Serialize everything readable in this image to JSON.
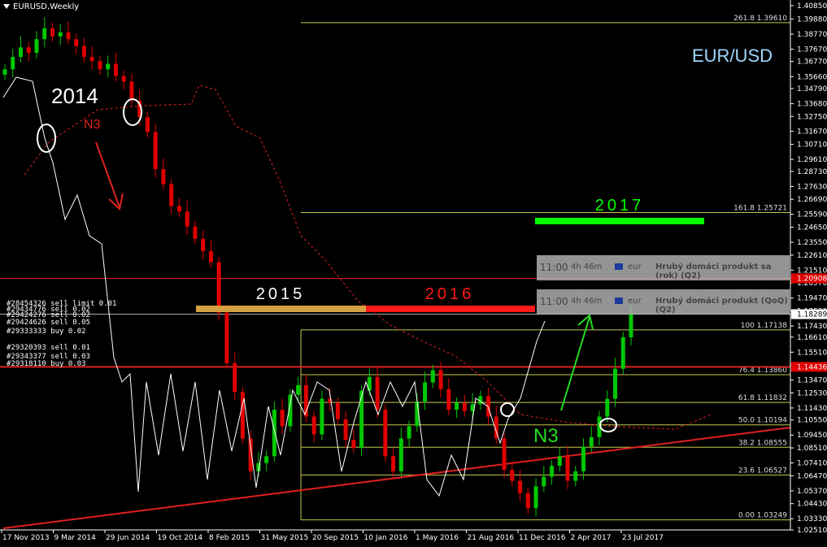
{
  "window": {
    "title": "EURUSD,Weekly"
  },
  "symbol_label": "EUR/USD",
  "colors": {
    "background": "#000000",
    "bull": "#00c800",
    "bear": "#e00000",
    "fib": "#c8c850",
    "trend": "#e02020",
    "line_white": "#ffffff",
    "y2017": "#00ff00",
    "y2016": "#ff1a1a",
    "y2015": "#d4a040"
  },
  "annotations": {
    "year_2014": "2014",
    "n3_red": "N3",
    "year_2015": "2015",
    "year_2016": "2016",
    "year_2017": "2017",
    "n3_green": "N3"
  },
  "calendar": [
    {
      "time": "11:00",
      "countdown": "4h 46m",
      "currency": "eur",
      "event": "Hrubý domáci produkt sa (rok) (Q2)"
    },
    {
      "time": "11:00",
      "countdown": "4h 46m",
      "currency": "eur",
      "event": "Hrubý domáci produkt (QoQ) (Q2)"
    }
  ],
  "order_labels": [
    "#28454326 sell limit 0.01",
    "#29434776 sell 0.02",
    "#29424276 sell 0.02",
    "#29424626 sell 0.05",
    "#29333333 buy 0.02",
    "#29320393 sell 0.01",
    "#29343377 sell 0.03",
    "#29318110 buy 0.03"
  ],
  "chart_data": {
    "type": "candlestick",
    "title": "EURUSD,Weekly",
    "y_axis_labels": [
      "1.40850",
      "1.39880",
      "1.38770",
      "1.37670",
      "1.36770",
      "1.35660",
      "1.34790",
      "1.33680",
      "1.32750",
      "1.31670",
      "1.30710",
      "1.29610",
      "1.28730",
      "1.27630",
      "1.26690",
      "1.25590",
      "1.24650",
      "1.23550",
      "1.22610",
      "1.21510",
      "1.20570",
      "1.19470",
      "1.18530",
      "1.17430",
      "1.16610",
      "1.15510",
      "1.14570",
      "1.13470",
      "1.12530",
      "1.11430",
      "1.10550",
      "1.09450",
      "1.08510",
      "1.07410",
      "1.06470",
      "1.05370",
      "1.04430",
      "1.03330",
      "1.02510"
    ],
    "ylim": [
      1.0251,
      1.4085
    ],
    "x_axis_labels": [
      "17 Nov 2013",
      "9 Mar 2014",
      "29 Jun 2014",
      "19 Oct 2014",
      "8 Feb 2015",
      "31 May 2015",
      "20 Sep 2015",
      "10 Jan 2016",
      "1 May 2016",
      "21 Aug 2016",
      "11 Dec 2016",
      "2 Apr 2017",
      "23 Jul 2017"
    ],
    "price_tags": [
      {
        "value": "1.20908",
        "color": "#e00000"
      },
      {
        "value": "1.18289",
        "color": "#ffffff"
      },
      {
        "value": "1.14436",
        "color": "#e00000"
      }
    ],
    "fibonacci": [
      {
        "level": "261.8",
        "price": "1.39610"
      },
      {
        "level": "161.8",
        "price": "1.25721"
      },
      {
        "level": "100",
        "price": "1.17138"
      },
      {
        "level": "76.4",
        "price": "1.13860"
      },
      {
        "level": "61.8",
        "price": "1.11832"
      },
      {
        "level": "50.0",
        "price": "1.10194"
      },
      {
        "level": "38.2",
        "price": "1.08555"
      },
      {
        "level": "23.6",
        "price": "1.06527"
      },
      {
        "level": "0.00",
        "price": "1.03249"
      }
    ],
    "closes": [
      1.362,
      1.371,
      1.378,
      1.374,
      1.384,
      1.392,
      1.386,
      1.389,
      1.384,
      1.379,
      1.371,
      1.368,
      1.362,
      1.366,
      1.357,
      1.353,
      1.339,
      1.327,
      1.316,
      1.289,
      1.278,
      1.262,
      1.258,
      1.247,
      1.238,
      1.229,
      1.221,
      1.184,
      1.147,
      1.126,
      1.092,
      1.068,
      1.074,
      1.079,
      1.113,
      1.101,
      1.124,
      1.131,
      1.108,
      1.095,
      1.121,
      1.118,
      1.106,
      1.091,
      1.085,
      1.127,
      1.137,
      1.113,
      1.079,
      1.068,
      1.092,
      1.101,
      1.119,
      1.133,
      1.142,
      1.128,
      1.113,
      1.118,
      1.112,
      1.117,
      1.123,
      1.108,
      1.092,
      1.069,
      1.061,
      1.052,
      1.041,
      1.057,
      1.064,
      1.072,
      1.079,
      1.061,
      1.068,
      1.086,
      1.093,
      1.108,
      1.121,
      1.143,
      1.166,
      1.183
    ]
  }
}
